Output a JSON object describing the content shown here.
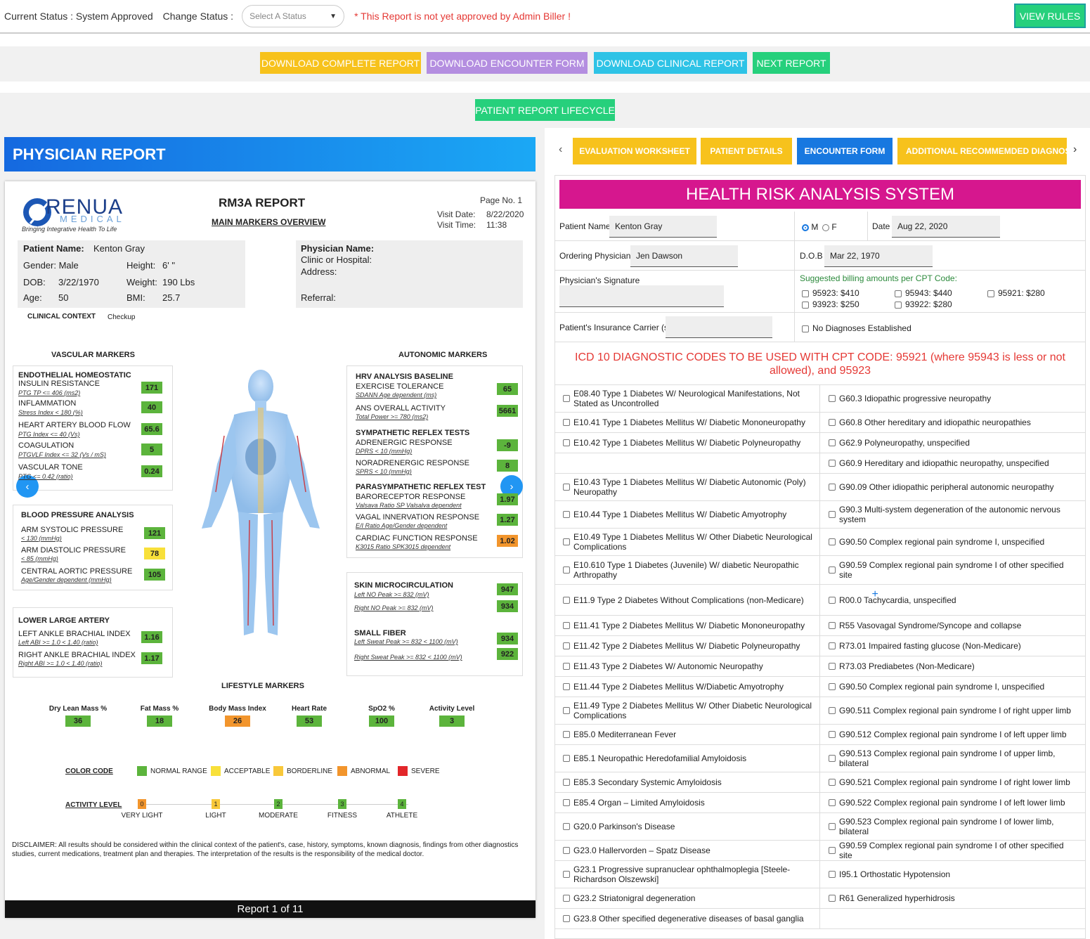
{
  "top": {
    "current_status": "Current Status : System Approved",
    "change_status": "Change Status :",
    "select_placeholder": "Select A Status",
    "warning": "* This Report is not yet approved by Admin Biller !",
    "view_rules": "VIEW RULES"
  },
  "actions": {
    "download_complete": "DOWNLOAD COMPLETE REPORT",
    "download_encounter": "DOWNLOAD ENCOUNTER FORM",
    "download_clinical": "DOWNLOAD CLINICAL REPORT",
    "next_report": "NEXT REPORT",
    "lifecycle": "PATIENT REPORT LIFECYCLE"
  },
  "physician_report": {
    "header": "PHYSICIAN REPORT",
    "logo_text": "RENUA",
    "logo_sub": "MEDICAL",
    "logo_tag": "Bringing Integrative Health To Life",
    "title": "RM3A REPORT",
    "subtitle": "MAIN MARKERS OVERVIEW",
    "page_no": "Page No. 1",
    "visit_date_label": "Visit Date:",
    "visit_date": "8/22/2020",
    "visit_time_label": "Visit Time:",
    "visit_time": "11:38",
    "patient_name_label": "Patient Name:",
    "patient_name": "Kenton Gray",
    "gender": "Gender: Male",
    "height_label": "Height:",
    "height": "6'  \"",
    "dob_label": "DOB:",
    "dob": "3/22/1970",
    "weight_label": "Weight:",
    "weight": "190 Lbs",
    "age_label": "Age:",
    "age": "50",
    "bmi_label": "BMI:",
    "bmi": "25.7",
    "physician_name_label": "Physician Name:",
    "clinic_label": "Clinic or Hospital:",
    "address_label": "Address:",
    "referral_label": "Referral:",
    "clinical_context_label": "CLINICAL CONTEXT",
    "clinical_context": "Checkup",
    "vascular_title": "VASCULAR MARKERS",
    "autonomic_title": "AUTONOMIC MARKERS",
    "vascular": [
      {
        "head": "ENDOTHELIAL HOMEOSTATIC",
        "label": "INSULIN RESISTANCE",
        "sub": "PTG TP <= 406 (ms2)",
        "value": "171",
        "color": "green"
      },
      {
        "head": "",
        "label": "INFLAMMATION",
        "sub": "Stress Index < 180 (%)",
        "value": "40",
        "color": "green"
      },
      {
        "head": "",
        "label": "HEART ARTERY BLOOD FLOW",
        "sub": "PTG Index <= 40 (Vs)",
        "value": "65.6",
        "color": "green"
      },
      {
        "head": "",
        "label": "COAGULATION",
        "sub": "PTGVLF Index <= 32 (Vs / mS)",
        "value": "5",
        "color": "green"
      },
      {
        "head": "",
        "label": "VASCULAR TONE",
        "sub": "PTG <= 0.42 (ratio)",
        "value": "0.24",
        "color": "green"
      }
    ],
    "bp_title": "BLOOD PRESSURE ANALYSIS",
    "bp": [
      {
        "label": "ARM SYSTOLIC PRESSURE",
        "sub": "< 130 (mmHg)",
        "value": "121",
        "color": "green"
      },
      {
        "label": "ARM DIASTOLIC PRESSURE",
        "sub": "< 85 (mmHg)",
        "value": "78",
        "color": "yellow"
      },
      {
        "label": "CENTRAL AORTIC PRESSURE",
        "sub": "Age/Gender dependent (mmHg)",
        "value": "105",
        "color": "green"
      }
    ],
    "lla_title": "LOWER LARGE ARTERY",
    "lla": [
      {
        "label": "LEFT ANKLE BRACHIAL INDEX",
        "sub": "Left ABI >= 1.0  < 1.40 (ratio)",
        "value": "1.16",
        "color": "green"
      },
      {
        "label": "RIGHT ANKLE BRACHIAL INDEX",
        "sub": "Right ABI >= 1.0  < 1.40 (ratio)",
        "value": "1.17",
        "color": "green"
      }
    ],
    "autonomic": [
      {
        "head": "HRV ANALYSIS BASELINE",
        "label": "EXERCISE TOLERANCE",
        "sub": "SDANN Age dependent (ms)",
        "value": "65",
        "color": "green"
      },
      {
        "head": "",
        "label": "ANS OVERALL ACTIVITY",
        "sub": "Total Power >= 780 (ms2)",
        "value": "5661",
        "color": "green"
      },
      {
        "head": "SYMPATHETIC REFLEX TESTS",
        "label": "ADRENERGIC RESPONSE",
        "sub": "DPRS < 10 (mmHg)",
        "value": "-9",
        "color": "green"
      },
      {
        "head": "",
        "label": "NORADRENERGIC RESPONSE",
        "sub": "SPRS < 10 (mmHg)",
        "value": "8",
        "color": "green"
      },
      {
        "head": "PARASYMPATHETIC REFLEX TEST",
        "label": "BARORECEPTOR RESPONSE",
        "sub": "Valsava Ratio SP Valsalva dependent",
        "value": "1.97",
        "color": "green"
      },
      {
        "head": "",
        "label": "VAGAL INNERVATION RESPONSE",
        "sub": "E/I Ratio Age/Gender dependent",
        "value": "1.27",
        "color": "green"
      },
      {
        "head": "",
        "label": "CARDIAC FUNCTION RESPONSE",
        "sub": "K3015 Ratio SPK3015 dependent",
        "value": "1.02",
        "color": "orange"
      }
    ],
    "skin_title": "SKIN MICROCIRCULATION",
    "skin": [
      {
        "sub": "Left NO Peak >= 832 (mV)",
        "value": "947",
        "color": "green"
      },
      {
        "sub": "Right NO Peak >= 832 (mV)",
        "value": "934",
        "color": "green"
      }
    ],
    "fiber_title": "SMALL FIBER",
    "fiber": [
      {
        "sub": "Left Sweat Peak >= 832   < 1100 (mV)",
        "value": "934",
        "color": "green"
      },
      {
        "sub": "Right Sweat Peak >= 832   < 1100 (mV)",
        "value": "922",
        "color": "green"
      }
    ],
    "lifestyle_title": "LIFESTYLE MARKERS",
    "lifestyle": [
      {
        "label": "Dry Lean Mass %",
        "value": "36",
        "color": "green"
      },
      {
        "label": "Fat Mass %",
        "value": "18",
        "color": "green"
      },
      {
        "label": "Body Mass Index",
        "value": "26",
        "color": "orange"
      },
      {
        "label": "Heart Rate",
        "value": "53",
        "color": "green"
      },
      {
        "label": "SpO2 %",
        "value": "100",
        "color": "green"
      },
      {
        "label": "Activity Level",
        "value": "3",
        "color": "green"
      }
    ],
    "color_code_label": "COLOR CODE",
    "color_codes": [
      {
        "label": "NORMAL RANGE",
        "color": "#5cb43c"
      },
      {
        "label": "ACCEPTABLE",
        "color": "#f8e03a"
      },
      {
        "label": "BORDERLINE",
        "color": "#f8c83a"
      },
      {
        "label": "ABNORMAL",
        "color": "#f2952c"
      },
      {
        "label": "SEVERE",
        "color": "#e2262a"
      }
    ],
    "activity_level_label": "ACTIVITY LEVEL",
    "activity_levels": [
      {
        "n": "0",
        "label": "VERY LIGHT",
        "color": "#f2952c"
      },
      {
        "n": "1",
        "label": "LIGHT",
        "color": "#f8c83a"
      },
      {
        "n": "2",
        "label": "MODERATE",
        "color": "#5cb43c"
      },
      {
        "n": "3",
        "label": "FITNESS",
        "color": "#5cb43c"
      },
      {
        "n": "4",
        "label": "ATHLETE",
        "color": "#5cb43c"
      }
    ],
    "disclaimer": "DISCLAIMER:  All results should be considered within the clinical context of the patient's, case, history, symptoms, known diagnosis, findings from other diagnostics studies, current medications, treatment plan and therapies. The interpretation of the results is the responsibility of the medical doctor.",
    "footer": "Report 1 of 11"
  },
  "tabs": {
    "evaluation": "EVALUATION WORKSHEET",
    "patient_details": "PATIENT DETAILS",
    "encounter": "ENCOUNTER FORM",
    "additional": "ADDITIONAL RECOMMEMDED DIAGNOSIS"
  },
  "form": {
    "title": "HEALTH RISK ANALYSIS SYSTEM",
    "patient_name_label": "Patient Name",
    "patient_name": "Kenton Gray",
    "sex_m": "M",
    "sex_f": "F",
    "date_label": "Date",
    "date": "Aug 22, 2020",
    "ordering_physician_label": "Ordering Physician",
    "ordering_physician": "Jen Dawson",
    "dob_label": "D.O.B",
    "dob": "Mar 22, 1970",
    "signature_label": "Physician's Signature",
    "billing_label": "Suggested billing amounts per CPT Code:",
    "billing": [
      "95923: $410",
      "95943: $440",
      "95921: $280",
      "93923: $250",
      "93922: $280"
    ],
    "insurance_label": "Patient's Insurance Carrier (s)",
    "no_diag": "No Diagnoses Established",
    "icd_title": "ICD 10 DIAGNOSTIC CODES TO BE USED WITH CPT CODE: 95921 (where 95943 is less or not allowed), and 95923"
  },
  "icd_rows": [
    [
      "E08.40 Type 1 Diabetes W/ Neurological Manifestations, Not Stated as Uncontrolled",
      "G60.3 Idiopathic progressive neuropathy"
    ],
    [
      "E10.41 Type 1 Diabetes Mellitus W/ Diabetic Mononeuropathy",
      "G60.8 Other hereditary and idiopathic neuropathies"
    ],
    [
      "E10.42 Type 1 Diabetes Mellitus W/ Diabetic Polyneuropathy",
      "G62.9 Polyneuropathy, unspecified"
    ],
    [
      "",
      "G60.9 Hereditary and idiopathic neuropathy, unspecified"
    ],
    [
      "E10.43 Type 1 Diabetes Mellitus W/ Diabetic Autonomic (Poly) Neuropathy",
      "G90.09 Other idiopathic peripheral autonomic neuropathy"
    ],
    [
      "E10.44 Type 1 Diabetes Mellitus W/ Diabetic Amyotrophy",
      "G90.3 Multi-system degeneration of the autonomic nervous system"
    ],
    [
      "E10.49 Type 1 Diabetes Mellitus W/ Other Diabetic Neurological Complications",
      "G90.50 Complex regional pain syndrome I, unspecified"
    ],
    [
      "E10.610 Type 1 Diabetes (Juvenile) W/ diabetic Neuropathic Arthropathy",
      "G90.59 Complex regional pain syndrome I of other specified site"
    ],
    [
      "E11.9 Type 2 Diabetes Without Complications (non-Medicare)",
      "R00.0 Tachycardia, unspecified"
    ],
    [
      "E11.41 Type 2 Diabetes Mellitus W/ Diabetic Mononeuropathy",
      "R55 Vasovagal Syndrome/Syncope and collapse"
    ],
    [
      "E11.42 Type 2 Diabetes Mellitus W/ Diabetic Polyneuropathy",
      "R73.01 Impaired fasting glucose (Non-Medicare)"
    ],
    [
      "E11.43 Type 2 Diabetes W/ Autonomic Neuropathy",
      "R73.03 Prediabetes (Non-Medicare)"
    ],
    [
      "E11.44 Type 2 Diabetes Mellitus W/Diabetic Amyotrophy",
      "G90.50 Complex regional pain syndrome I, unspecified"
    ],
    [
      "E11.49 Type 2 Diabetes Mellitus W/ Other Diabetic Neurological Complications",
      "G90.511 Complex regional pain syndrome I of right upper limb"
    ],
    [
      "E85.0 Mediterranean Fever",
      "G90.512 Complex regional pain syndrome I of left upper limb"
    ],
    [
      "E85.1 Neuropathic Heredofamilial Amyloidosis",
      "G90.513 Complex regional pain syndrome I of upper limb, bilateral"
    ],
    [
      "E85.3 Secondary Systemic Amyloidosis",
      "G90.521 Complex regional pain syndrome I of right lower limb"
    ],
    [
      "E85.4 Organ – Limited Amyloidosis",
      "G90.522 Complex regional pain syndrome I of left lower limb"
    ],
    [
      "G20.0 Parkinson's Disease",
      "G90.523 Complex regional pain syndrome I of lower limb, bilateral"
    ],
    [
      "G23.0 Hallervorden – Spatz Disease",
      "G90.59 Complex regional pain syndrome I of other specified site"
    ],
    [
      "G23.1 Progressive supranuclear ophthalmoplegia [Steele-Richardson Olszewski]",
      "I95.1 Orthostatic Hypotension"
    ],
    [
      "G23.2 Striatonigral degeneration",
      "R61 Generalized hyperhidrosis"
    ],
    [
      "G23.8 Other specified degenerative diseases of basal ganglia",
      ""
    ]
  ]
}
